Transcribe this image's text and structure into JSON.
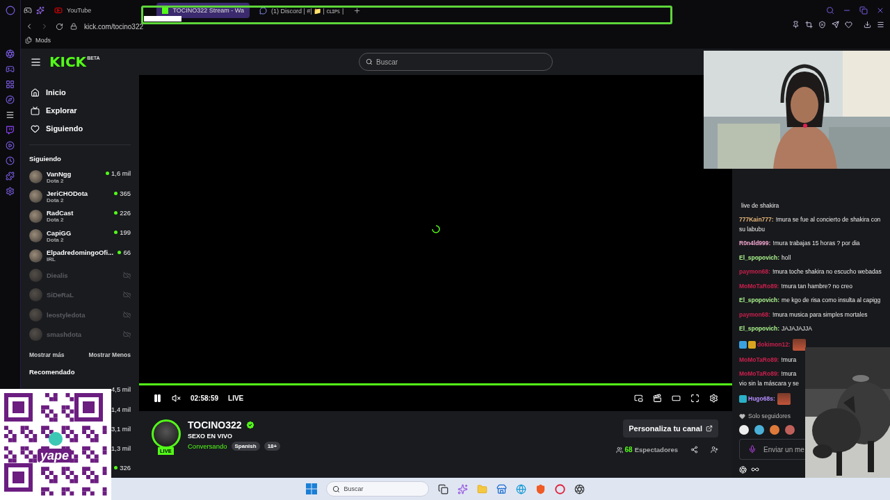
{
  "browser": {
    "tabs": [
      {
        "title": "YouTube",
        "kind": "youtube",
        "selected": false
      },
      {
        "title": "TOCINO322 Stream - Wa",
        "kind": "kick",
        "selected": true
      },
      {
        "title": "(1) Discord | #| 📁 | ᴄʟɪᴘꜱ |",
        "kind": "discord",
        "selected": false
      }
    ],
    "address": "kick.com/tocino322",
    "bookmarks": [
      "Mods"
    ]
  },
  "header": {
    "logo": "KICK",
    "logo_badge": "BETA",
    "search": {
      "placeholder": "Buscar"
    }
  },
  "nav": [
    {
      "label": "Inicio",
      "kind": "home"
    },
    {
      "label": "Explorar",
      "kind": "explore"
    },
    {
      "label": "Siguiendo",
      "kind": "following"
    }
  ],
  "following": {
    "title": "Siguiendo",
    "channels": [
      {
        "name": "VanNgg",
        "game": "Dota 2",
        "viewers": "1,6 mil",
        "online": true
      },
      {
        "name": "JeriCHODota",
        "game": "Dota 2",
        "viewers": "365",
        "online": true
      },
      {
        "name": "RadCast",
        "game": "Dota 2",
        "viewers": "226",
        "online": true
      },
      {
        "name": "CapiGG",
        "game": "Dota 2",
        "viewers": "199",
        "online": true
      },
      {
        "name": "ElpadredomingoOfi...",
        "game": "IRL",
        "viewers": "66",
        "online": true
      },
      {
        "name": "Diealis",
        "online": false
      },
      {
        "name": "SiDeRaL",
        "online": false
      },
      {
        "name": "leostyledota",
        "online": false
      },
      {
        "name": "smashdota",
        "online": false
      }
    ],
    "show_more": "Mostrar más",
    "show_less": "Mostrar Menos"
  },
  "recommended": {
    "title": "Recomendado",
    "channels": [
      {
        "viewers": "4,5 mil",
        "dot": false
      },
      {
        "viewers": "1,4 mil",
        "dot": false
      },
      {
        "viewers": "3,1 mil",
        "dot": false
      },
      {
        "viewers": "1,3 mil",
        "dot": false
      },
      {
        "viewers": "326",
        "dot": true
      }
    ]
  },
  "player": {
    "level": 1,
    "time": "02:58:59",
    "live": "LIVE"
  },
  "channel": {
    "name": "TOCINO322",
    "verified": true,
    "live_badge": "LIVE",
    "title": "SEXO EN VIVO",
    "category": "Conversando",
    "tags": [
      "Spanish",
      "18+"
    ],
    "customize": "Personaliza tu canal",
    "viewers": "68",
    "viewers_label": "Espectadores"
  },
  "chat": {
    "messages": [
      {
        "text": "live de shakira"
      },
      {
        "user": "777Kain777:",
        "color": "#e8b87c",
        "text": "!mura se fue al concierto de shakira con su labubu"
      },
      {
        "user": "R0n4ld999:",
        "color": "#f2a7cf",
        "text": "!mura trabajas 15 horas ? por dia"
      },
      {
        "user": "El_spopovich:",
        "color": "#a8f28c",
        "text": "holl"
      },
      {
        "user": "paymon68:",
        "color": "#c8204e",
        "text": "!mura toche shakira no escucho webadas"
      },
      {
        "user": "MoMoTaRo89:",
        "color": "#c8204e",
        "text": "!mura tan hambre? no creo"
      },
      {
        "user": "El_spopovich:",
        "color": "#a8f28c",
        "text": "me kgo de risa como insulta al capigg"
      },
      {
        "user": "paymon68:",
        "color": "#c8204e",
        "text": "!mura musica para simples mortales"
      },
      {
        "user": "El_spopovich:",
        "color": "#a8f28c",
        "text": "JAJAJAJJA"
      },
      {
        "user": "dokimon12:",
        "color": "#c8204e",
        "badges": [
          {
            "color": "#3aa0e0"
          },
          {
            "color": "#d9a520"
          }
        ],
        "emote": true
      },
      {
        "user": "MoMoTaRo89:",
        "color": "#c8204e",
        "text": "!mura"
      },
      {
        "user": "MoMoTaRo89:",
        "color": "#c8204e",
        "text": "!mura\nvio sin la máscara y se"
      },
      {
        "user": "Hugo68s:",
        "color": "#b48cff",
        "badges": [
          {
            "color": "#2ab0c8"
          }
        ],
        "emote": true
      }
    ],
    "mode": "Solo seguidores",
    "input": {
      "placeholder": "Enviar un me"
    }
  },
  "qr": {
    "logo_text": "yape"
  },
  "taskbar": {
    "search": {
      "placeholder": "Buscar"
    }
  }
}
